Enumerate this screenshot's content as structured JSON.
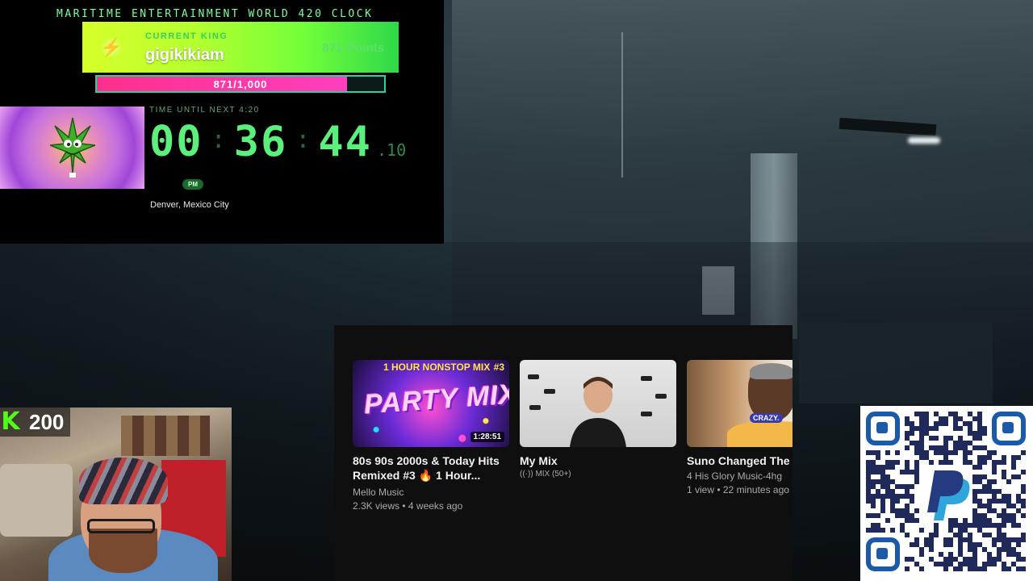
{
  "clock": {
    "title": "MARITIME ENTERTAINMENT WORLD 420 CLOCK",
    "king_label": "CURRENT KING",
    "king_name": "gigikikiam",
    "king_points_value": "871",
    "king_points_unit": "Points",
    "progress_text": "871/1,000",
    "progress_fraction": 0.871,
    "timer_label": "TIME UNTIL NEXT 4:20",
    "hours": "00",
    "minutes": "36",
    "seconds": "44",
    "hundredths": ".10",
    "ampm": "PM",
    "cities": "Denver, Mexico City"
  },
  "youtube": {
    "videos": [
      {
        "thumb_header": "1 HOUR NONSTOP MIX",
        "thumb_number": "#3",
        "thumb_text": "PARTY MIX",
        "duration": "1:28:51",
        "title_line1": "80s 90s 2000s & Today Hits",
        "title_line2": "Remixed #3 🔥 1 Hour...",
        "channel": "Mello Music",
        "stats": "2.3K views • 4 weeks ago"
      },
      {
        "title_line1": "My Mix",
        "mix_label": "MIX (50+)"
      },
      {
        "thumb_badge": "CRAZY.",
        "title_line1": "Suno Changed The C",
        "channel": "4 His Glory Music-4hg",
        "stats": "1 view • 22 minutes ago"
      }
    ]
  },
  "webcam": {
    "kick_count": "200",
    "kick_icon": "kick-logo-icon"
  },
  "qr": {
    "icon": "paypal-logo-icon"
  },
  "colors": {
    "clock_green": "#5bf07c",
    "progress_pink": "#ff2f8c",
    "kick_green": "#53fc18",
    "youtube_bg": "#0f0f0f"
  }
}
